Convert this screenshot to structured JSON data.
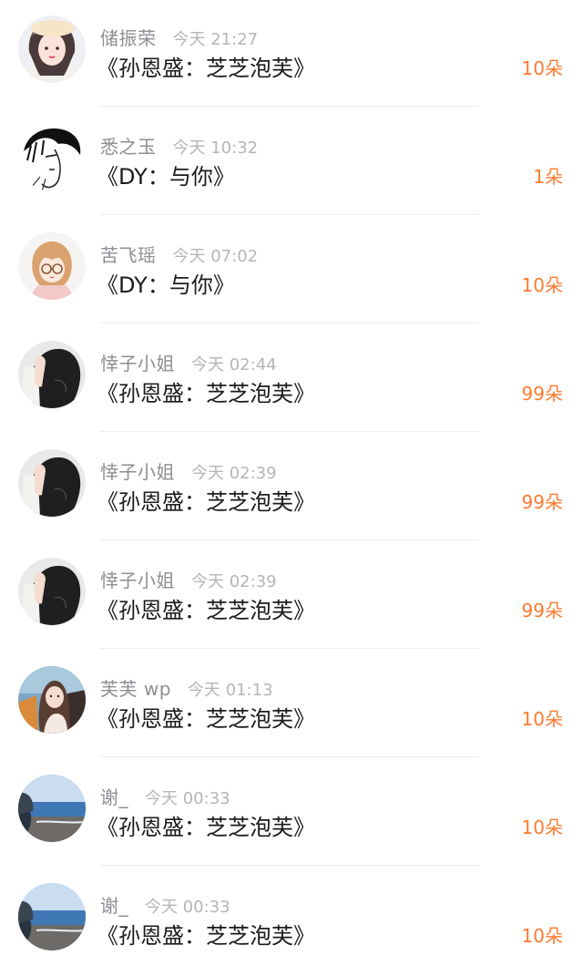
{
  "gift_list": {
    "items": [
      {
        "user": "储振荣",
        "time": "今天 21:27",
        "gift": "《孙恩盛：芝芝泡芙》",
        "count": "10朵",
        "avatar_icon": "girl-beret-avatar-icon"
      },
      {
        "user": "悉之玉",
        "time": "今天 10:32",
        "gift": "《DY：与你》",
        "count": "1朵",
        "avatar_icon": "sketch-face-avatar-icon"
      },
      {
        "user": "苦飞瑶",
        "time": "今天 07:02",
        "gift": "《DY：与你》",
        "count": "10朵",
        "avatar_icon": "anime-glasses-girl-avatar-icon"
      },
      {
        "user": "悻子小姐",
        "time": "今天 02:44",
        "gift": "《孙恩盛：芝芝泡芙》",
        "count": "99朵",
        "avatar_icon": "dark-hair-girl-avatar-icon"
      },
      {
        "user": "悻子小姐",
        "time": "今天 02:39",
        "gift": "《孙恩盛：芝芝泡芙》",
        "count": "99朵",
        "avatar_icon": "dark-hair-girl-avatar-icon"
      },
      {
        "user": "悻子小姐",
        "time": "今天 02:39",
        "gift": "《孙恩盛：芝芝泡芙》",
        "count": "99朵",
        "avatar_icon": "dark-hair-girl-avatar-icon"
      },
      {
        "user": "芙芙 wp",
        "time": "今天 01:13",
        "gift": "《孙恩盛：芝芝泡芙》",
        "count": "10朵",
        "avatar_icon": "girl-car-avatar-icon"
      },
      {
        "user": "谢_",
        "time": "今天 00:33",
        "gift": "《孙恩盛：芝芝泡芙》",
        "count": "10朵",
        "avatar_icon": "seaside-avatar-icon"
      },
      {
        "user": "谢_",
        "time": "今天 00:33",
        "gift": "《孙恩盛：芝芝泡芙》",
        "count": "10朵",
        "avatar_icon": "seaside-avatar-icon"
      }
    ]
  },
  "colors": {
    "count": "#ff7a2f",
    "name": "#8e8e93",
    "time": "#b5b5ba",
    "gift": "#1c1c1e",
    "divider": "#ededed"
  }
}
